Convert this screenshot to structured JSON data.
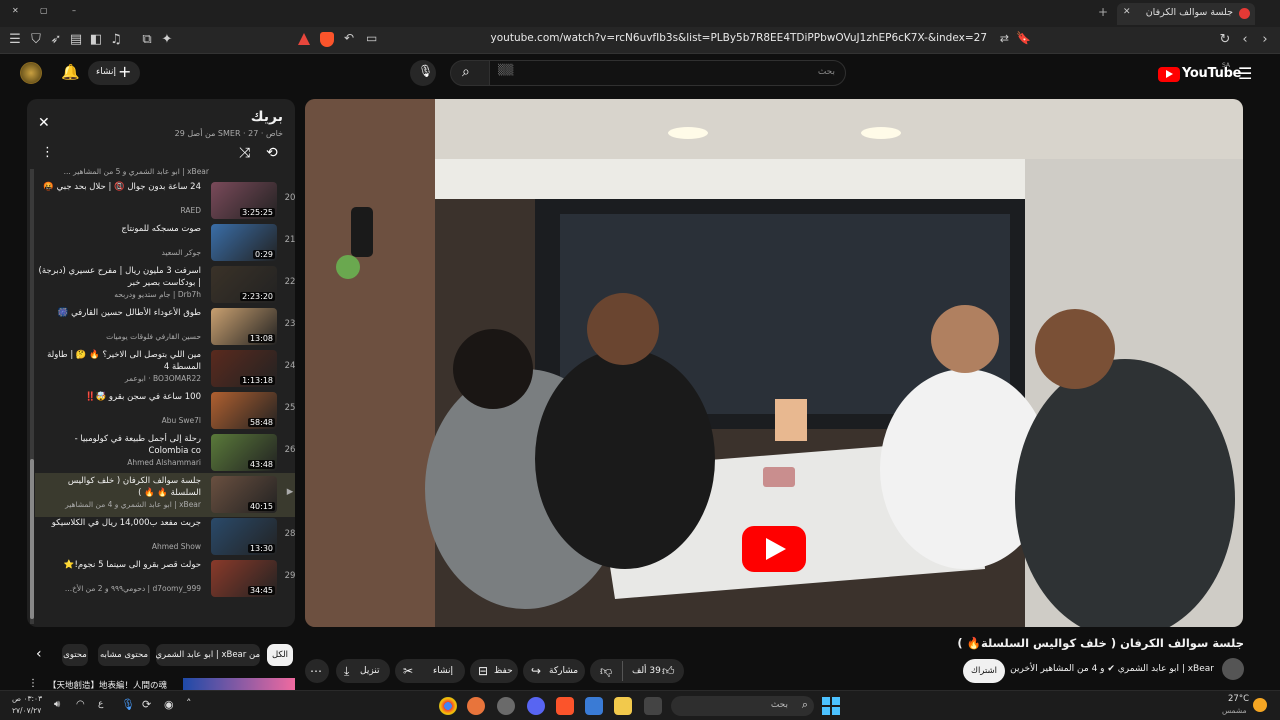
{
  "browser": {
    "tab_title": "جلسة سوالف الكرفان ( خلف كوا",
    "url": "youtube.com/watch?v=rcN6uvfIb3s&list=PLBy5b7R8EE4TDiPPbwOVuJ1zhEP6cK7X-&index=27",
    "new_tab": "+",
    "win_min": "–",
    "win_max": "▢",
    "win_close": "✕"
  },
  "header": {
    "logo": "YouTube",
    "logo_region": "SA",
    "search_placeholder": "بحث",
    "search_value": "▒▒",
    "create_label": "إنشاء"
  },
  "playlist": {
    "title": "بريك",
    "meta": "خاص · SMER · 27 من أصل 29",
    "top_partial": "xBear | ابو عابد الشمري و 5 من المشاهير ...",
    "items": [
      {
        "index": "20",
        "title": "24 ساعة بدون جوال 📵 | حلال بحد جبي 🤬",
        "channel": "RAED",
        "duration": "3:25:25",
        "color": "#7a4a5a"
      },
      {
        "index": "21",
        "title": "صوت مسجكه للمونتاج",
        "channel": "جوكر السعيد",
        "duration": "0:29",
        "color": "#3a6ea8"
      },
      {
        "index": "22",
        "title": "اسرفت 3 مليون ريال | مفرح عسيري (دبرجة) | بودكاست بصير خبر",
        "channel": "Drb7h | جام ستديو ودربحه",
        "duration": "2:23:20",
        "color": "#3a3228"
      },
      {
        "index": "23",
        "title": "طوق الأعوداء الأطالل حسين القارفي 🎆",
        "channel": "حسين القارفي فلوقات يوميات",
        "duration": "13:08",
        "color": "#c9a070"
      },
      {
        "index": "24",
        "title": "مين اللي بتوصل الى الاخير؟ 🔥 🤔 | طاولة المسطة 4",
        "channel": "BO3OMAR22 · ابوعمر",
        "duration": "1:13:18",
        "color": "#5a2a1e"
      },
      {
        "index": "25",
        "title": "100 ساعة في سجن بقرو 🤯‼️",
        "channel": "Abu Swe7l",
        "duration": "58:48",
        "color": "#b06030"
      },
      {
        "index": "26",
        "title": "رحلة إلى أجمل طبيعة في كولومبيا - Colombia co",
        "channel": "Ahmed Alshammari",
        "duration": "43:48",
        "color": "#5a7a3a"
      },
      {
        "index": "▶",
        "title": "جلسة سوالف الكرفان ( خلف كواليس السلسلة 🔥 🔥 )",
        "channel": "xBear | ابو عابد الشمري و 4 من المشاهير",
        "duration": "40:15",
        "color": "#6a5040"
      },
      {
        "index": "28",
        "title": "جربت مفعد ب14,000 ريال في الكلاسيكو",
        "channel": "Ahmed Show",
        "duration": "13:30",
        "color": "#2a4a6a"
      },
      {
        "index": "29",
        "title": "حولت قصر بقرو الى سينما 5 نجوم!⭐",
        "channel": "d7oomy_999 | دحومي٩٩٩ و 2 من الأخ...",
        "duration": "34:45",
        "color": "#8a3a2a"
      }
    ]
  },
  "video": {
    "title": "جلسة سوالف الكرفان ( خلف كواليس السلسلة🔥 )"
  },
  "chips": [
    "الكل",
    "من xBear | ابو عابد الشمري",
    "محتوى مشابه",
    "محتوى"
  ],
  "channel": {
    "name": "xBear | ابو عابد الشمري ✔ و 4 من المشاهير الأخرين",
    "subscribe": "اشتراك"
  },
  "actions": {
    "likes": "39 ألف",
    "share": "مشاركة",
    "save": "حفظ",
    "clip": "إنشاء مقطع",
    "download": "تنزيل"
  },
  "next_video_title": "【天地創造】地表編！人間の魂",
  "taskbar": {
    "search": "بحث",
    "weather_temp": "27°C",
    "weather_desc": "مشمس",
    "time": "٠٣:٠٣ ص",
    "date": "٢٧/٠٧/٢٧",
    "lang": "ع"
  }
}
